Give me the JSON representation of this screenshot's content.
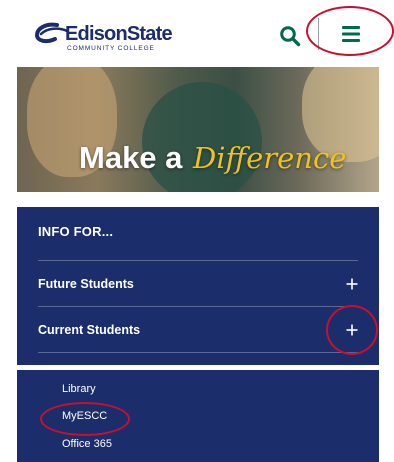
{
  "header": {
    "logo_name": "EdisonState",
    "logo_subtitle": "COMMUNITY COLLEGE",
    "search_icon": "search-icon",
    "menu_icon": "hamburger-menu-icon"
  },
  "hero": {
    "text_main": "Make a",
    "text_script": "Difference"
  },
  "info": {
    "title": "INFO FOR...",
    "items": [
      {
        "label": "Future Students",
        "icon": "plus-icon"
      },
      {
        "label": "Current Students",
        "icon": "plus-icon"
      }
    ]
  },
  "links": [
    {
      "label": "Library"
    },
    {
      "label": "MyESCC"
    },
    {
      "label": "Office 365"
    }
  ],
  "colors": {
    "brand_navy": "#1c2d6b",
    "accent_green": "#006a4e",
    "annotation_red": "#c8102e",
    "script_gold": "#f0c21b"
  }
}
